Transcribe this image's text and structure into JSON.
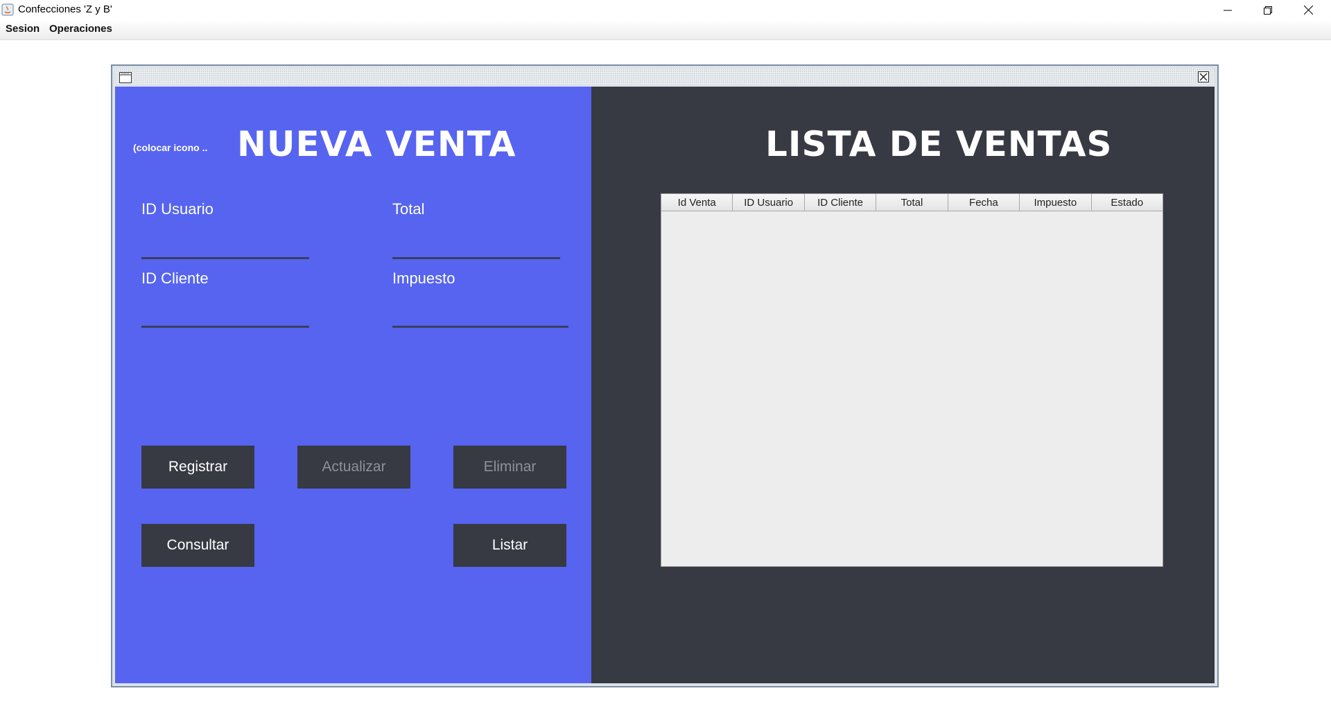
{
  "window": {
    "title": "Confecciones 'Z y B'"
  },
  "menu": {
    "items": [
      "Sesion",
      "Operaciones"
    ]
  },
  "left_panel": {
    "icon_placeholder": "(colocar icono ..",
    "title": "NUEVA VENTA",
    "fields": {
      "id_usuario": {
        "label": "ID Usuario",
        "value": ""
      },
      "total": {
        "label": "Total",
        "value": ""
      },
      "id_cliente": {
        "label": "ID Cliente",
        "value": ""
      },
      "impuesto": {
        "label": "Impuesto",
        "value": ""
      }
    },
    "buttons": {
      "registrar": "Registrar",
      "actualizar": "Actualizar",
      "eliminar": "Eliminar",
      "consultar": "Consultar",
      "listar": "Listar"
    },
    "colors": {
      "background": "#5664f0",
      "button": "#373a42"
    }
  },
  "right_panel": {
    "title": "LISTA DE VENTAS",
    "table": {
      "columns": [
        "Id Venta",
        "ID Usuario",
        "ID Cliente",
        "Total",
        "Fecha",
        "Impuesto",
        "Estado"
      ],
      "rows": []
    },
    "colors": {
      "background": "#373a42"
    }
  },
  "icons": [
    "java-app-icon",
    "minimize-icon",
    "restore-icon",
    "close-icon",
    "internal-frame-icon",
    "internal-frame-close-icon"
  ]
}
